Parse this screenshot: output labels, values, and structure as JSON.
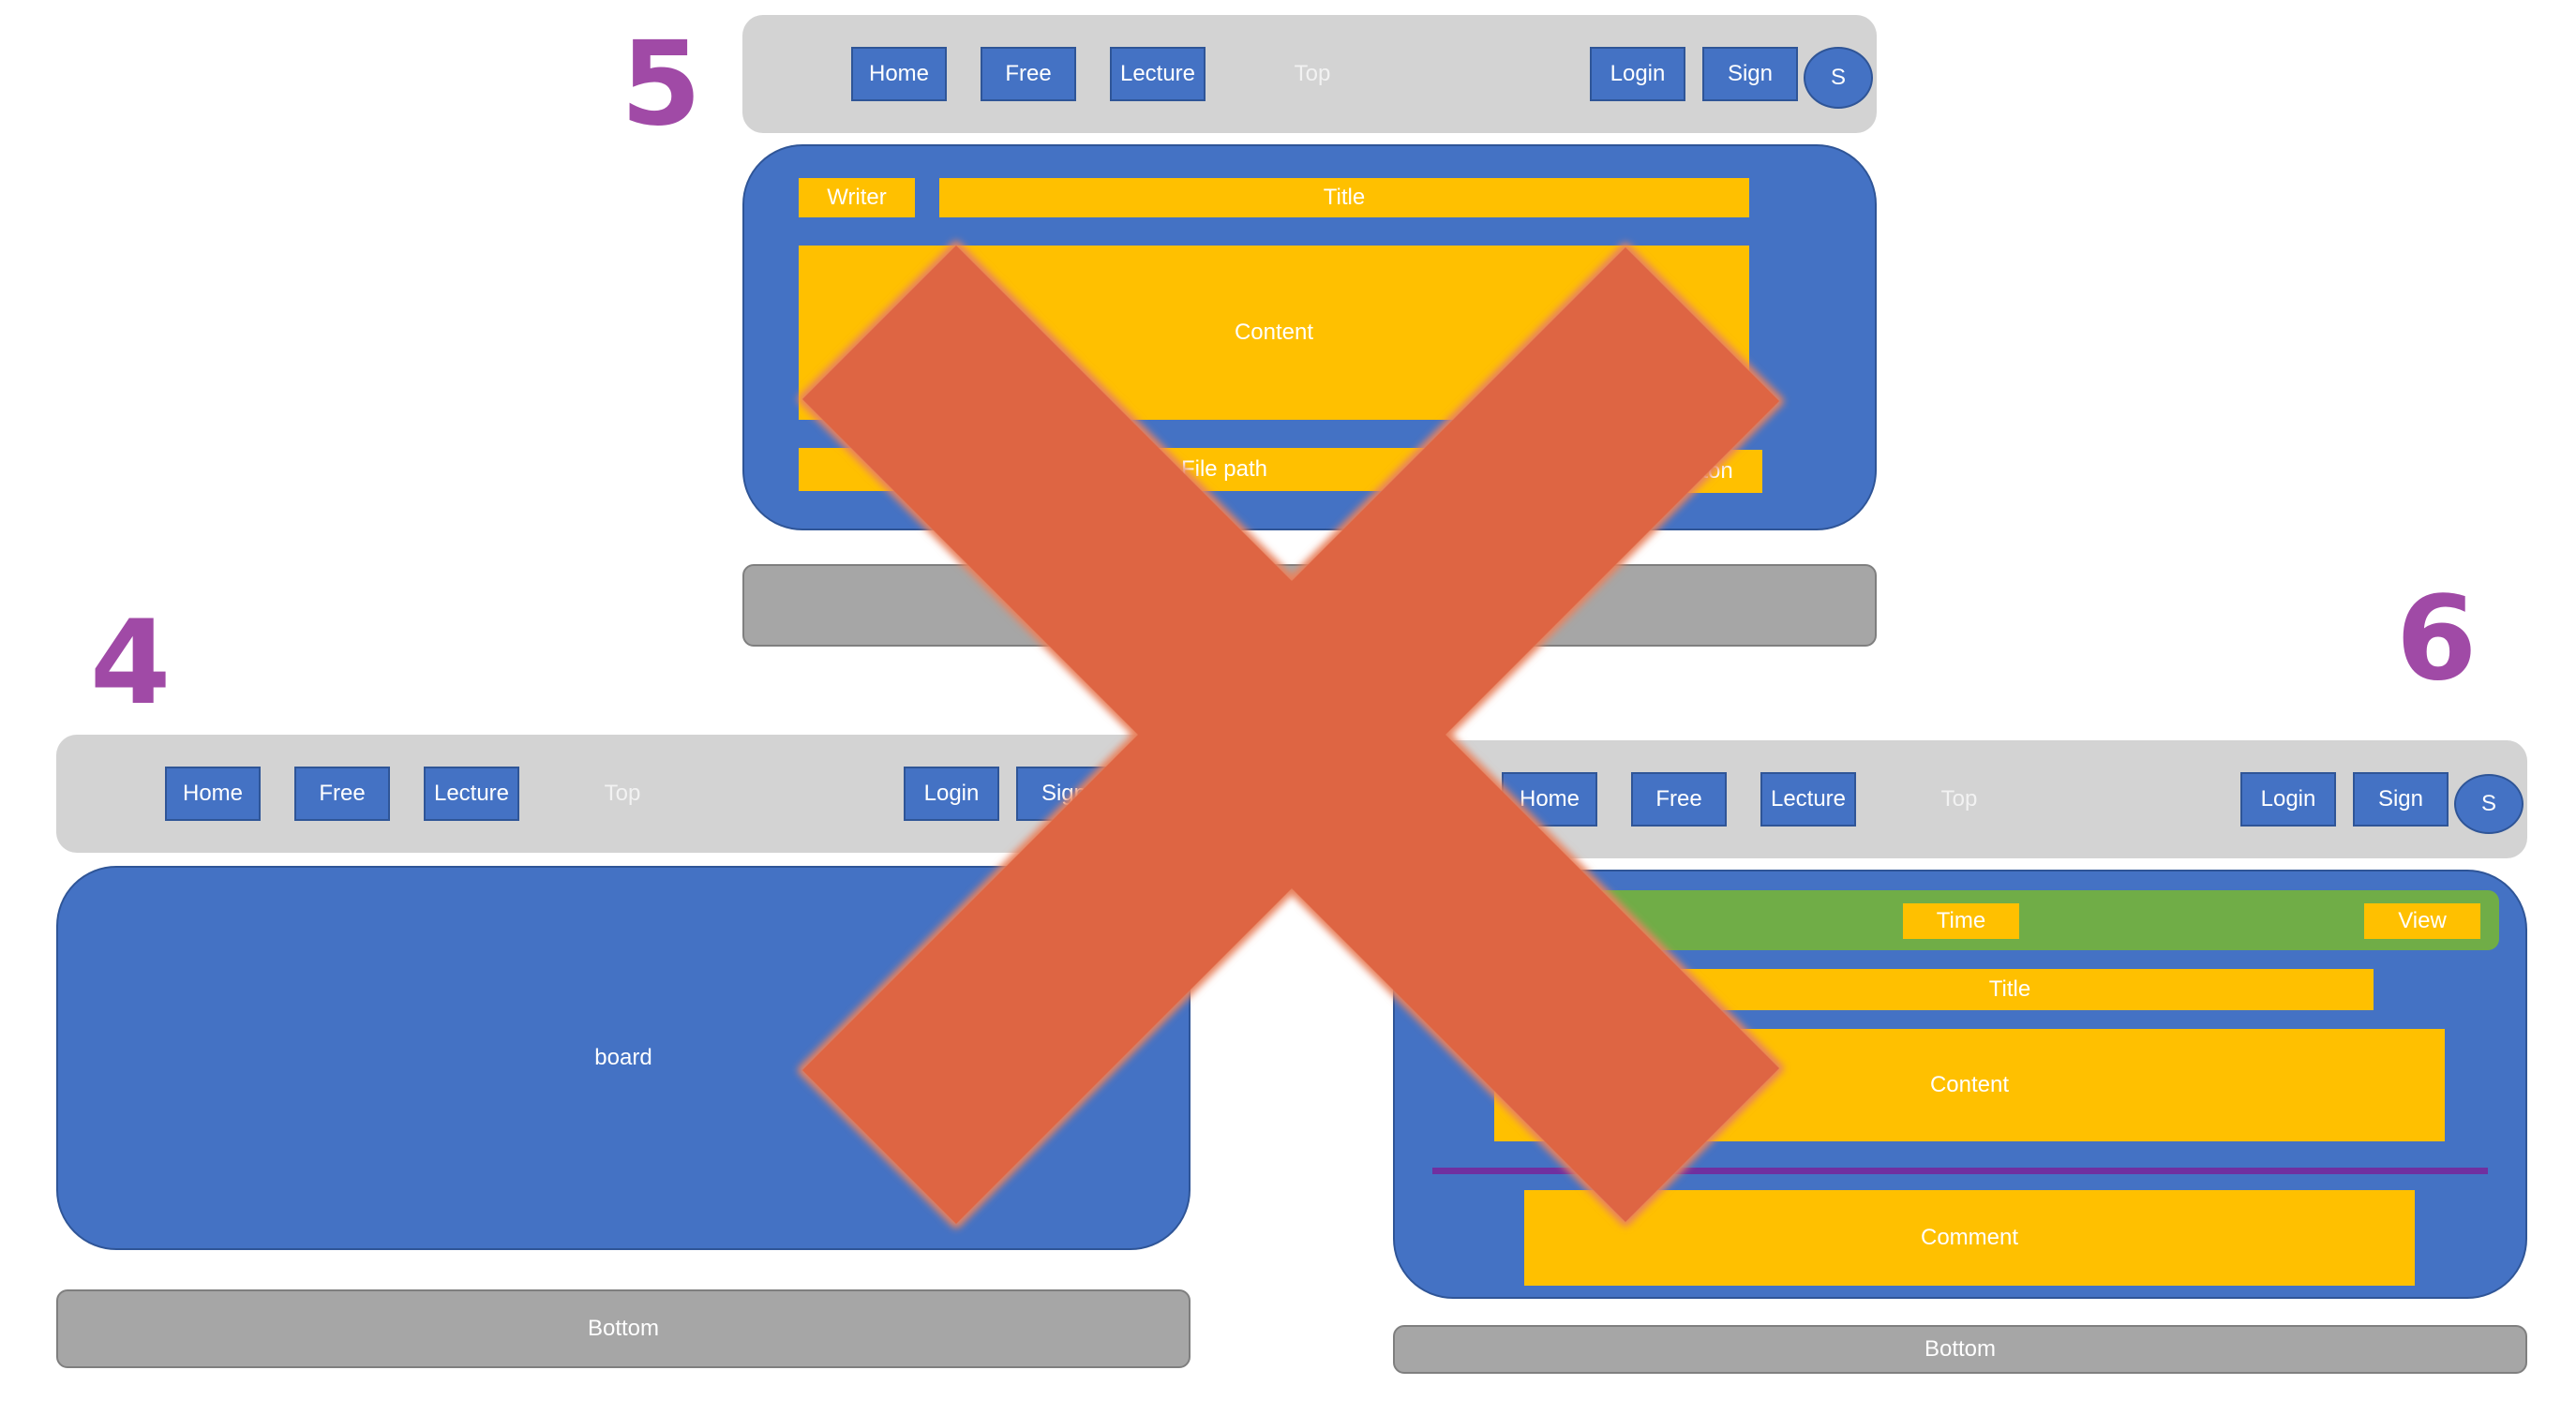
{
  "numbers": {
    "five": "5",
    "four": "4",
    "six": "6"
  },
  "colors": {
    "number": "#a04aa6",
    "bar": "#d3d3d3",
    "blue": "#4472c4",
    "yellow": "#ffc000",
    "green": "#70ad47",
    "gray": "#a6a6a6",
    "divider": "#7030a0",
    "cross": "#de6543"
  },
  "nav": {
    "home": "Home",
    "free": "Free",
    "lecture": "Lecture",
    "top": "Top",
    "login": "Login",
    "sign": "Sign",
    "avatar": "S"
  },
  "nav4": {
    "home": "Home",
    "free": "Free",
    "lecture": "Lecture",
    "top": "Top",
    "login": "Login",
    "sign": "Sign"
  },
  "page5": {
    "writer": "Writer",
    "title": "Title",
    "content": "Content",
    "file_path": "File path",
    "button": "Button"
  },
  "page4": {
    "board": "board",
    "bottom": "Bottom"
  },
  "page6": {
    "time": "Time",
    "view": "View",
    "title": "Title",
    "content": "Content",
    "comment": "Comment",
    "bottom": "Bottom"
  },
  "overlay": {
    "icon": "red-cross-icon"
  }
}
